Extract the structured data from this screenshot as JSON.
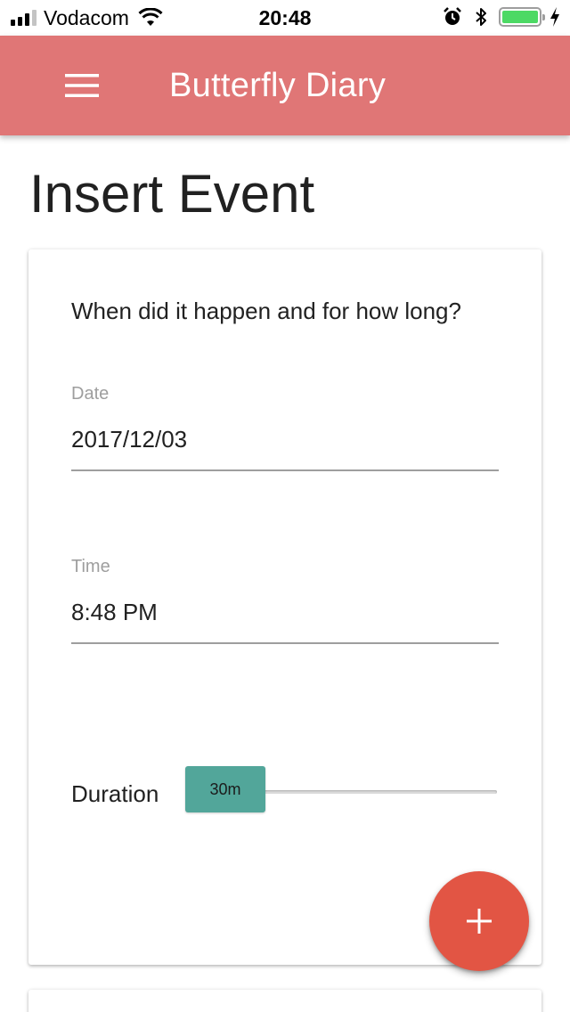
{
  "status_bar": {
    "carrier": "Vodacom",
    "time": "20:48",
    "signal_bars_filled": 3,
    "signal_bars_total": 4,
    "battery_level": 1.0,
    "battery_color": "#4cd964"
  },
  "app_bar": {
    "title": "Butterfly Diary",
    "menu_icon": "menu-icon",
    "color": "#e07676"
  },
  "page": {
    "title": "Insert Event"
  },
  "form": {
    "question": "When did it happen and for how long?",
    "date": {
      "label": "Date",
      "value": "2017/12/03"
    },
    "time": {
      "label": "Time",
      "value": "8:48 PM"
    },
    "duration": {
      "label": "Duration",
      "value_label": "30m",
      "slider_level": 0.0,
      "accent": "#52a69a"
    }
  },
  "fab": {
    "icon": "plus-icon",
    "color": "#e25544"
  }
}
